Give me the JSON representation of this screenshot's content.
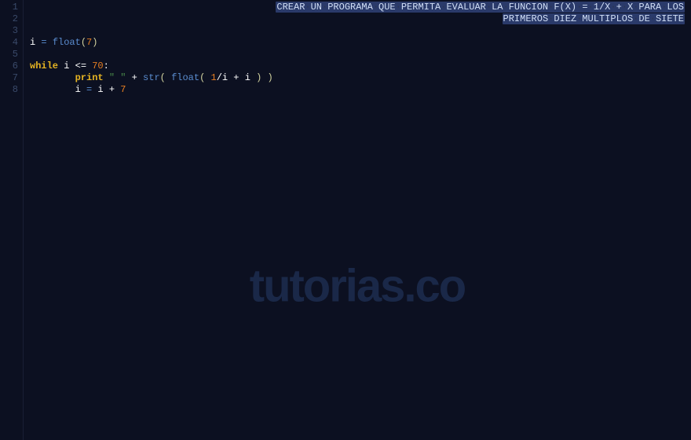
{
  "gutter": {
    "lines": [
      "1",
      "2",
      "3",
      "4",
      "5",
      "6",
      "7",
      "8"
    ]
  },
  "comment": {
    "line1_parts": [
      "CREAR",
      "UN",
      "PROGRAMA",
      "QUE",
      "PERMITA",
      "EVALUAR",
      "LA",
      "FUNCION",
      "F(X)",
      "=",
      "1/X",
      "+",
      "X",
      "PARA",
      "LOS"
    ],
    "line2_parts": [
      "PRIMEROS",
      "DIEZ",
      "MULTIPLOS",
      "DE",
      "SIETE"
    ]
  },
  "code": {
    "l4": {
      "var": "i",
      "assign": "=",
      "builtin": "float",
      "lparen": "(",
      "num": "7",
      "rparen": ")"
    },
    "l6": {
      "kw": "while",
      "var": "i",
      "op": "<=",
      "num": "70",
      "colon": ":"
    },
    "l7": {
      "kw": "print",
      "str": "\" \"",
      "plus1": "+",
      "str_fn": "str",
      "lparen1": "(",
      "float_fn": "float",
      "lparen2": "(",
      "one": "1",
      "slash": "/",
      "var1": "i",
      "plus2": "+",
      "var2": "i",
      "rparen1": ")",
      "rparen2": ")"
    },
    "l8": {
      "var1": "i",
      "assign": "=",
      "var2": "i",
      "plus": "+",
      "num": "7"
    }
  },
  "watermark": "tutorias.co"
}
